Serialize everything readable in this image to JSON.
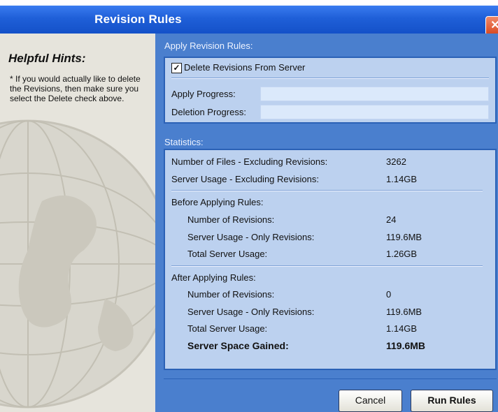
{
  "window": {
    "title": "Revision Rules",
    "close_glyph": "✕"
  },
  "hints": {
    "title": "Helpful Hints:",
    "text": "* If you would actually like to delete the Revisions, then make sure you select the Delete check above."
  },
  "apply": {
    "group_label": "Apply Revision Rules:",
    "delete_checkbox": {
      "label": "Delete Revisions From Server",
      "checked": true
    },
    "apply_progress": {
      "label": "Apply Progress:",
      "percent": 0
    },
    "deletion_progress": {
      "label": "Deletion Progress:",
      "percent": 0
    }
  },
  "statistics": {
    "group_label": "Statistics:",
    "files_excl_label": "Number of Files - Excluding Revisions:",
    "files_excl_value": "3262",
    "usage_excl_label": "Server Usage - Excluding Revisions:",
    "usage_excl_value": "1.14GB",
    "before": {
      "heading": "Before Applying Rules:",
      "revisions_label": "Number of Revisions:",
      "revisions_value": "24",
      "usage_only_label": "Server Usage - Only Revisions:",
      "usage_only_value": "119.6MB",
      "total_label": "Total Server Usage:",
      "total_value": "1.26GB"
    },
    "after": {
      "heading": "After Applying Rules:",
      "revisions_label": "Number of Revisions:",
      "revisions_value": "0",
      "usage_only_label": "Server Usage - Only Revisions:",
      "usage_only_value": "119.6MB",
      "total_label": "Total Server Usage:",
      "total_value": "1.14GB",
      "gained_label": "Server Space Gained:",
      "gained_value": "119.6MB"
    }
  },
  "buttons": {
    "cancel": "Cancel",
    "run": "Run Rules"
  },
  "colors": {
    "title_bar": "#1f5fd8",
    "panel_background": "#4a7fce",
    "group_box": "#bcd1ef",
    "close_button": "#d8471f"
  }
}
